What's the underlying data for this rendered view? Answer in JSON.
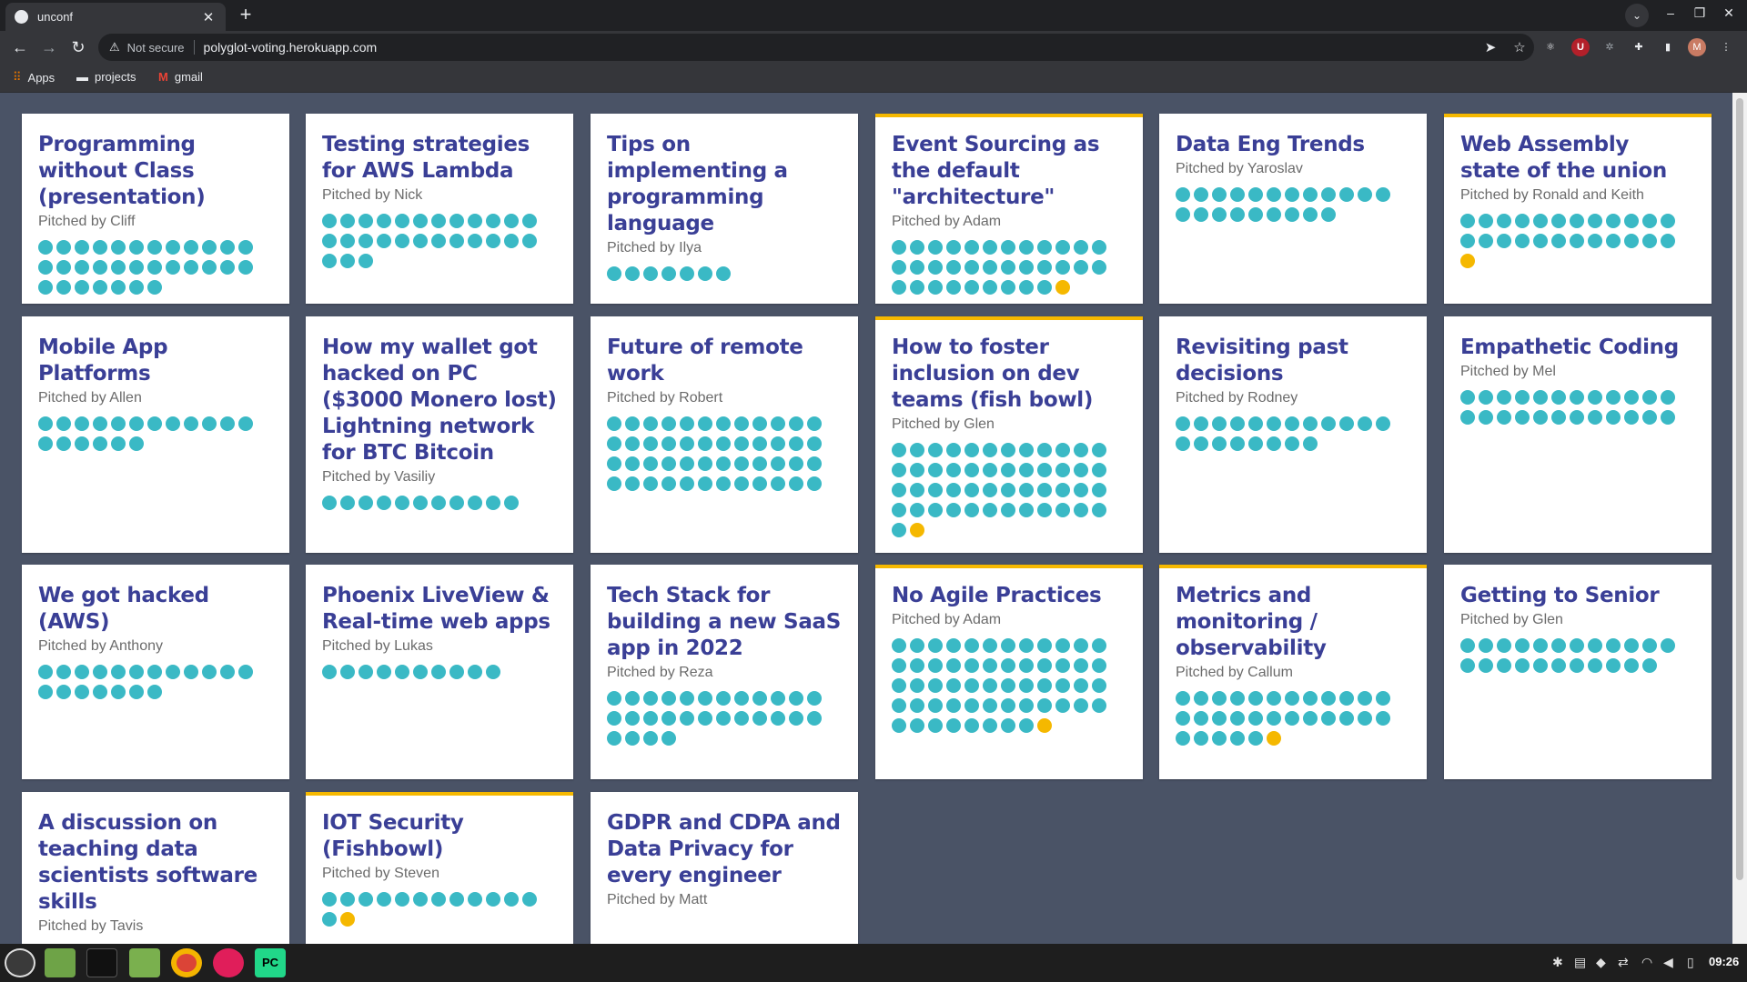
{
  "browser": {
    "tab_title": "unconf",
    "security_label": "Not secure",
    "url": "polyglot-voting.herokuapp.com",
    "bookmarks": [
      "Apps",
      "projects",
      "gmail"
    ],
    "extension_u_label": "U",
    "extension_avatar_label": "M"
  },
  "page": {
    "dot_color": "#3ab9c5",
    "highlight_color": "#f5b800",
    "title_color": "#3a3f96",
    "background": "#4a5366",
    "cards": [
      {
        "title": "Programming without Class (presentation)",
        "pitch": "Pitched by Cliff",
        "teal": 31,
        "gold": 0,
        "featured": false
      },
      {
        "title": "Testing strategies for AWS Lambda",
        "pitch": "Pitched by Nick",
        "teal": 27,
        "gold": 0,
        "featured": false
      },
      {
        "title": "Tips on implementing a programming language",
        "pitch": "Pitched by Ilya",
        "teal": 7,
        "gold": 0,
        "featured": false
      },
      {
        "title": "Event Sourcing as the default \"architecture\"",
        "pitch": "Pitched by Adam",
        "teal": 33,
        "gold": 1,
        "featured": true
      },
      {
        "title": "Data Eng Trends",
        "pitch": "Pitched by Yaroslav",
        "teal": 21,
        "gold": 0,
        "featured": false
      },
      {
        "title": "Web Assembly state of the union",
        "pitch": "Pitched by Ronald and Keith",
        "teal": 24,
        "gold": 1,
        "featured": true
      },
      {
        "title": "Mobile App Platforms",
        "pitch": "Pitched by Allen",
        "teal": 18,
        "gold": 0,
        "featured": false
      },
      {
        "title": "How my wallet got hacked on PC ($3000 Monero lost) Lightning network for BTC Bitcoin",
        "pitch": "Pitched by Vasiliy",
        "teal": 11,
        "gold": 0,
        "featured": false
      },
      {
        "title": "Future of remote work",
        "pitch": "Pitched by Robert",
        "teal": 48,
        "gold": 0,
        "featured": false
      },
      {
        "title": "How to foster inclusion on dev teams (fish bowl)",
        "pitch": "Pitched by Glen",
        "teal": 49,
        "gold": 1,
        "featured": true
      },
      {
        "title": "Revisiting past decisions",
        "pitch": "Pitched by Rodney",
        "teal": 20,
        "gold": 0,
        "featured": false
      },
      {
        "title": "Empathetic Coding",
        "pitch": "Pitched by Mel",
        "teal": 24,
        "gold": 0,
        "featured": false
      },
      {
        "title": "We got hacked (AWS)",
        "pitch": "Pitched by Anthony",
        "teal": 19,
        "gold": 0,
        "featured": false
      },
      {
        "title": "Phoenix LiveView & Real-time web apps",
        "pitch": "Pitched by Lukas",
        "teal": 10,
        "gold": 0,
        "featured": false
      },
      {
        "title": "Tech Stack for building a new SaaS app in 2022",
        "pitch": "Pitched by Reza",
        "teal": 28,
        "gold": 0,
        "featured": false
      },
      {
        "title": "No Agile Practices",
        "pitch": "Pitched by Adam",
        "teal": 56,
        "gold": 1,
        "featured": true
      },
      {
        "title": "Metrics and monitoring / observability",
        "pitch": "Pitched by Callum",
        "teal": 29,
        "gold": 1,
        "featured": true
      },
      {
        "title": "Getting to Senior",
        "pitch": "Pitched by Glen",
        "teal": 23,
        "gold": 0,
        "featured": false
      },
      {
        "title": "A discussion on teaching data scientists software skills",
        "pitch": "Pitched by Tavis",
        "teal": 0,
        "gold": 0,
        "featured": false
      },
      {
        "title": "IOT Security (Fishbowl)",
        "pitch": "Pitched by Steven",
        "teal": 13,
        "gold": 1,
        "featured": true
      },
      {
        "title": "GDPR and CDPA and Data Privacy for every engineer",
        "pitch": "Pitched by Matt",
        "teal": 0,
        "gold": 0,
        "featured": false
      }
    ]
  },
  "taskbar": {
    "clock": "09:26",
    "pycharm_label": "PC"
  }
}
